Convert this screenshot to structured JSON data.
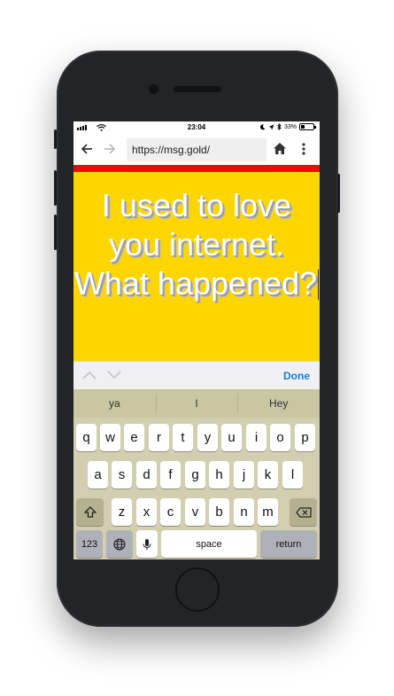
{
  "status_bar": {
    "time": "23:04",
    "battery_percent": "33%",
    "battery_level": 0.33
  },
  "browser": {
    "url": "https://msg.gold/",
    "icons": [
      "back-arrow-icon",
      "forward-arrow-icon",
      "home-icon",
      "overflow-menu-icon"
    ]
  },
  "content": {
    "message": "I used to love you internet. What happened?",
    "background_color": "#fdd600",
    "progress_color": "#f00a0a"
  },
  "accessory_bar": {
    "done_label": "Done"
  },
  "keyboard": {
    "suggestions": [
      "ya",
      "I",
      "Hey"
    ],
    "rows": [
      [
        "q",
        "w",
        "e",
        "r",
        "t",
        "y",
        "u",
        "i",
        "o",
        "p"
      ],
      [
        "a",
        "s",
        "d",
        "f",
        "g",
        "h",
        "j",
        "k",
        "l"
      ],
      [
        "z",
        "x",
        "c",
        "v",
        "b",
        "n",
        "m"
      ]
    ],
    "numbers_label": "123",
    "space_label": "space",
    "return_label": "return"
  }
}
